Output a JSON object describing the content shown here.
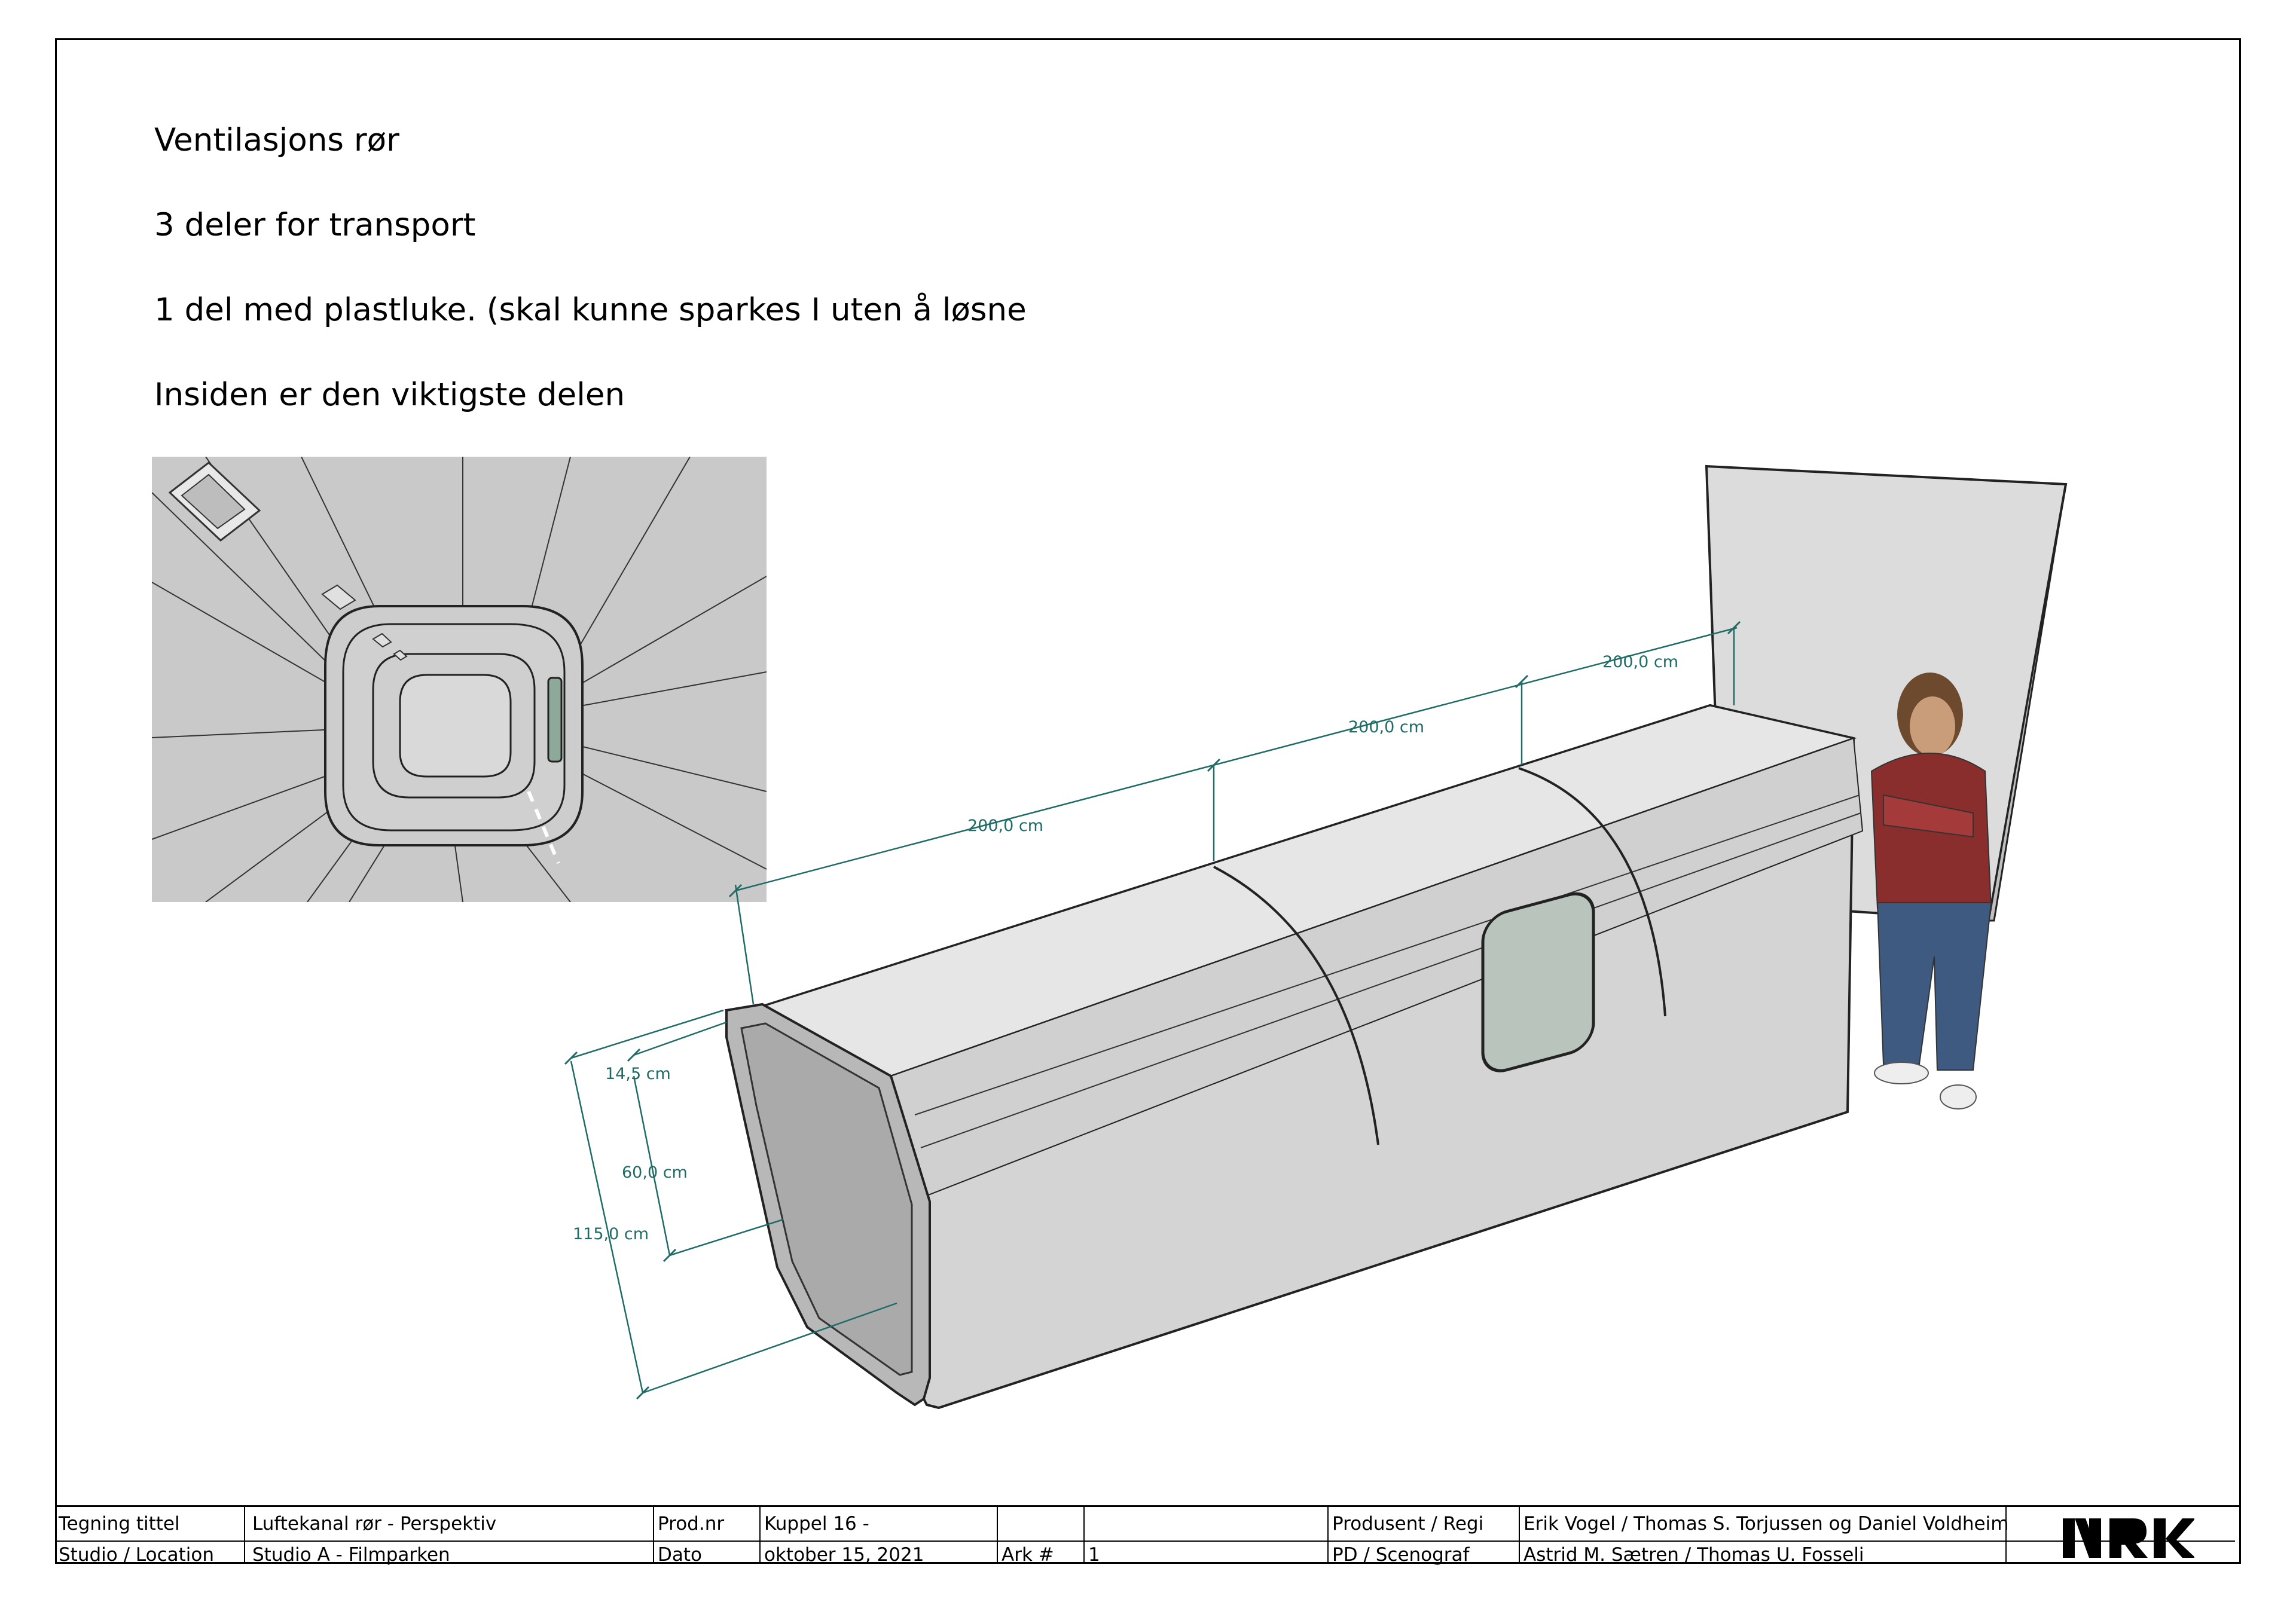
{
  "notes": {
    "line1": "Ventilasjons rør",
    "line2": "3 deler for transport",
    "line3": "1 del med plastluke. (skal kunne sparkes I uten å løsne",
    "line4": "Insiden er den viktigste delen"
  },
  "dimensions": {
    "section1": "200,0 cm",
    "section2": "200,0 cm",
    "section3": "200,0 cm",
    "bevel": "14,5 cm",
    "inner_height": "60,0 cm",
    "total_height": "115,0 cm"
  },
  "title_block": {
    "drawing_title_label": "Tegning tittel",
    "drawing_title_value": "Luftekanal rør - Perspektiv",
    "prod_nr_label": "Prod.nr",
    "prod_nr_value": "Kuppel 16 -",
    "producer_label": "Produsent / Regi",
    "producer_value": "Erik Vogel / Thomas S. Torjussen og Daniel Voldheim",
    "studio_label": "Studio / Location",
    "studio_value": "Studio A - Filmparken",
    "date_label": "Dato",
    "date_value": "oktober 15, 2021",
    "sheet_label": "Ark #",
    "sheet_value": "1",
    "pd_label": "PD / Scenograf",
    "pd_value": "Astrid M. Sætren / Thomas U. Fosseli"
  },
  "logo_name": "nrk-logo",
  "colors": {
    "dimension": "#1f6b66",
    "duct": "#d4d4d4",
    "inset_bg": "#c9c9c9"
  }
}
